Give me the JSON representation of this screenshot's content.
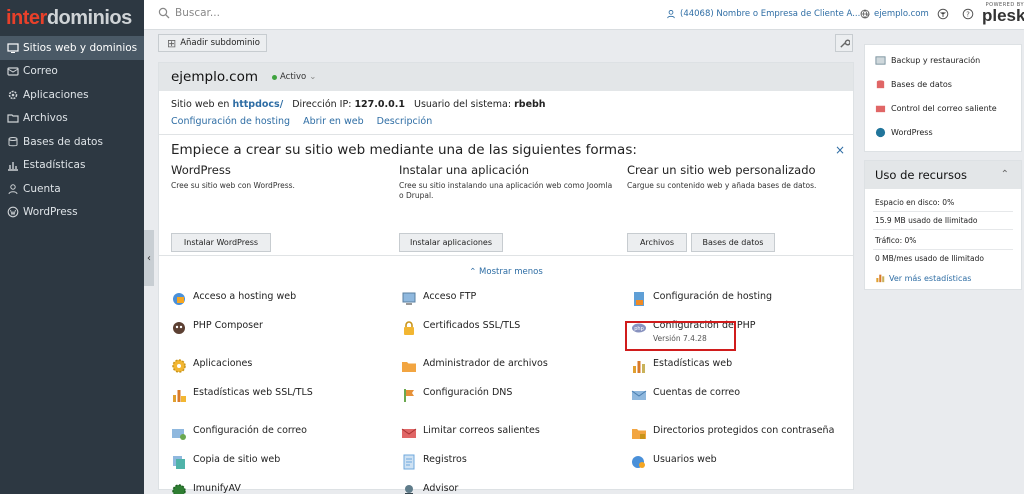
{
  "brand": {
    "part1": "inter",
    "part2": "dominios"
  },
  "sidebar": {
    "items": [
      {
        "label": "Sitios web y dominios",
        "icon": "globe-icon",
        "active": true
      },
      {
        "label": "Correo",
        "icon": "mail-icon"
      },
      {
        "label": "Aplicaciones",
        "icon": "gear-icon"
      },
      {
        "label": "Archivos",
        "icon": "folder-icon"
      },
      {
        "label": "Bases de datos",
        "icon": "database-icon"
      },
      {
        "label": "Estadísticas",
        "icon": "chart-icon"
      },
      {
        "label": "Cuenta",
        "icon": "user-icon"
      },
      {
        "label": "WordPress",
        "icon": "wordpress-icon"
      }
    ]
  },
  "topbar": {
    "search_placeholder": "Buscar...",
    "account": "(44068) Nombre o Empresa de Cliente A...",
    "domain": "ejemplo.com",
    "plesk_powered": "POWERED BY",
    "plesk_name": "plesk"
  },
  "toolbar": {
    "add_subdomain": "Añadir subdominio"
  },
  "site": {
    "domain": "ejemplo.com",
    "status": "Activo",
    "info_site_prefix": "Sitio web en",
    "info_site_path": "httpdocs/",
    "info_ip_label": "Dirección IP:",
    "info_ip_value": "127.0.0.1",
    "info_user_label": "Usuario del sistema:",
    "info_user_value": "rbebh",
    "links": [
      "Configuración de hosting",
      "Abrir en web",
      "Descripción"
    ]
  },
  "start": {
    "title": "Empiece a crear su sitio web mediante una de las siguientes formas:",
    "close": "×",
    "columns": [
      {
        "title": "WordPress",
        "desc": "Cree su sitio web con WordPress.",
        "buttons": [
          "Instalar WordPress"
        ]
      },
      {
        "title": "Instalar una aplicación",
        "desc": "Cree su sitio instalando una aplicación web como Joomla o Drupal.",
        "buttons": [
          "Instalar aplicaciones"
        ]
      },
      {
        "title": "Crear un sitio web personalizado",
        "desc": "Cargue su contenido web y añada bases de datos.",
        "buttons": [
          "Archivos",
          "Bases de datos"
        ]
      }
    ],
    "show_less": "⌃ Mostrar menos"
  },
  "tools": [
    {
      "label": "Acceso a hosting web",
      "icon": "hosting-access-icon"
    },
    {
      "label": "Acceso FTP",
      "icon": "ftp-icon"
    },
    {
      "label": "Configuración de hosting",
      "icon": "hosting-settings-icon"
    },
    {
      "label": "PHP Composer",
      "icon": "composer-icon"
    },
    {
      "label": "Certificados SSL/TLS",
      "icon": "lock-icon"
    },
    {
      "label": "Configuración de PHP",
      "icon": "php-icon",
      "sub": "Versión 7.4.28"
    },
    {
      "label": "Aplicaciones",
      "icon": "gear-icon"
    },
    {
      "label": "Administrador de archivos",
      "icon": "folder-icon"
    },
    {
      "label": "Estadísticas web",
      "icon": "chart-icon"
    },
    {
      "label": "Estadísticas web SSL/TLS",
      "icon": "chart-ssl-icon"
    },
    {
      "label": "Configuración DNS",
      "icon": "dns-icon"
    },
    {
      "label": "Cuentas de correo",
      "icon": "mail-icon"
    },
    {
      "label": "Configuración de correo",
      "icon": "mail-settings-icon"
    },
    {
      "label": "Limitar correos salientes",
      "icon": "mail-limit-icon"
    },
    {
      "label": "Directorios protegidos con contraseña",
      "icon": "protected-folder-icon"
    },
    {
      "label": "Copia de sitio web",
      "icon": "copy-icon"
    },
    {
      "label": "Registros",
      "icon": "logs-icon"
    },
    {
      "label": "Usuarios web",
      "icon": "web-users-icon"
    },
    {
      "label": "ImunifyAV",
      "icon": "imunify-icon"
    },
    {
      "label": "Advisor",
      "icon": "advisor-icon"
    }
  ],
  "right": {
    "links": [
      {
        "label": "Backup y restauración",
        "icon": "backup-icon"
      },
      {
        "label": "Bases de datos",
        "icon": "database-icon"
      },
      {
        "label": "Control del correo saliente",
        "icon": "mail-icon"
      },
      {
        "label": "WordPress",
        "icon": "wordpress-icon"
      }
    ],
    "resources": {
      "title": "Uso de recursos",
      "disk_label": "Espacio en disco: 0%",
      "disk_used": "15.9 MB usado de Ilimitado",
      "traffic_label": "Tráfico: 0%",
      "traffic_used": "0 MB/mes usado de Ilimitado",
      "more": "Ver más estadísticas"
    }
  },
  "colors": {
    "accent": "#2e6da4",
    "sidebar": "#2d3842",
    "brand_red": "#e8402a",
    "highlight": "#d01c1c",
    "active": "#3fa33f"
  }
}
